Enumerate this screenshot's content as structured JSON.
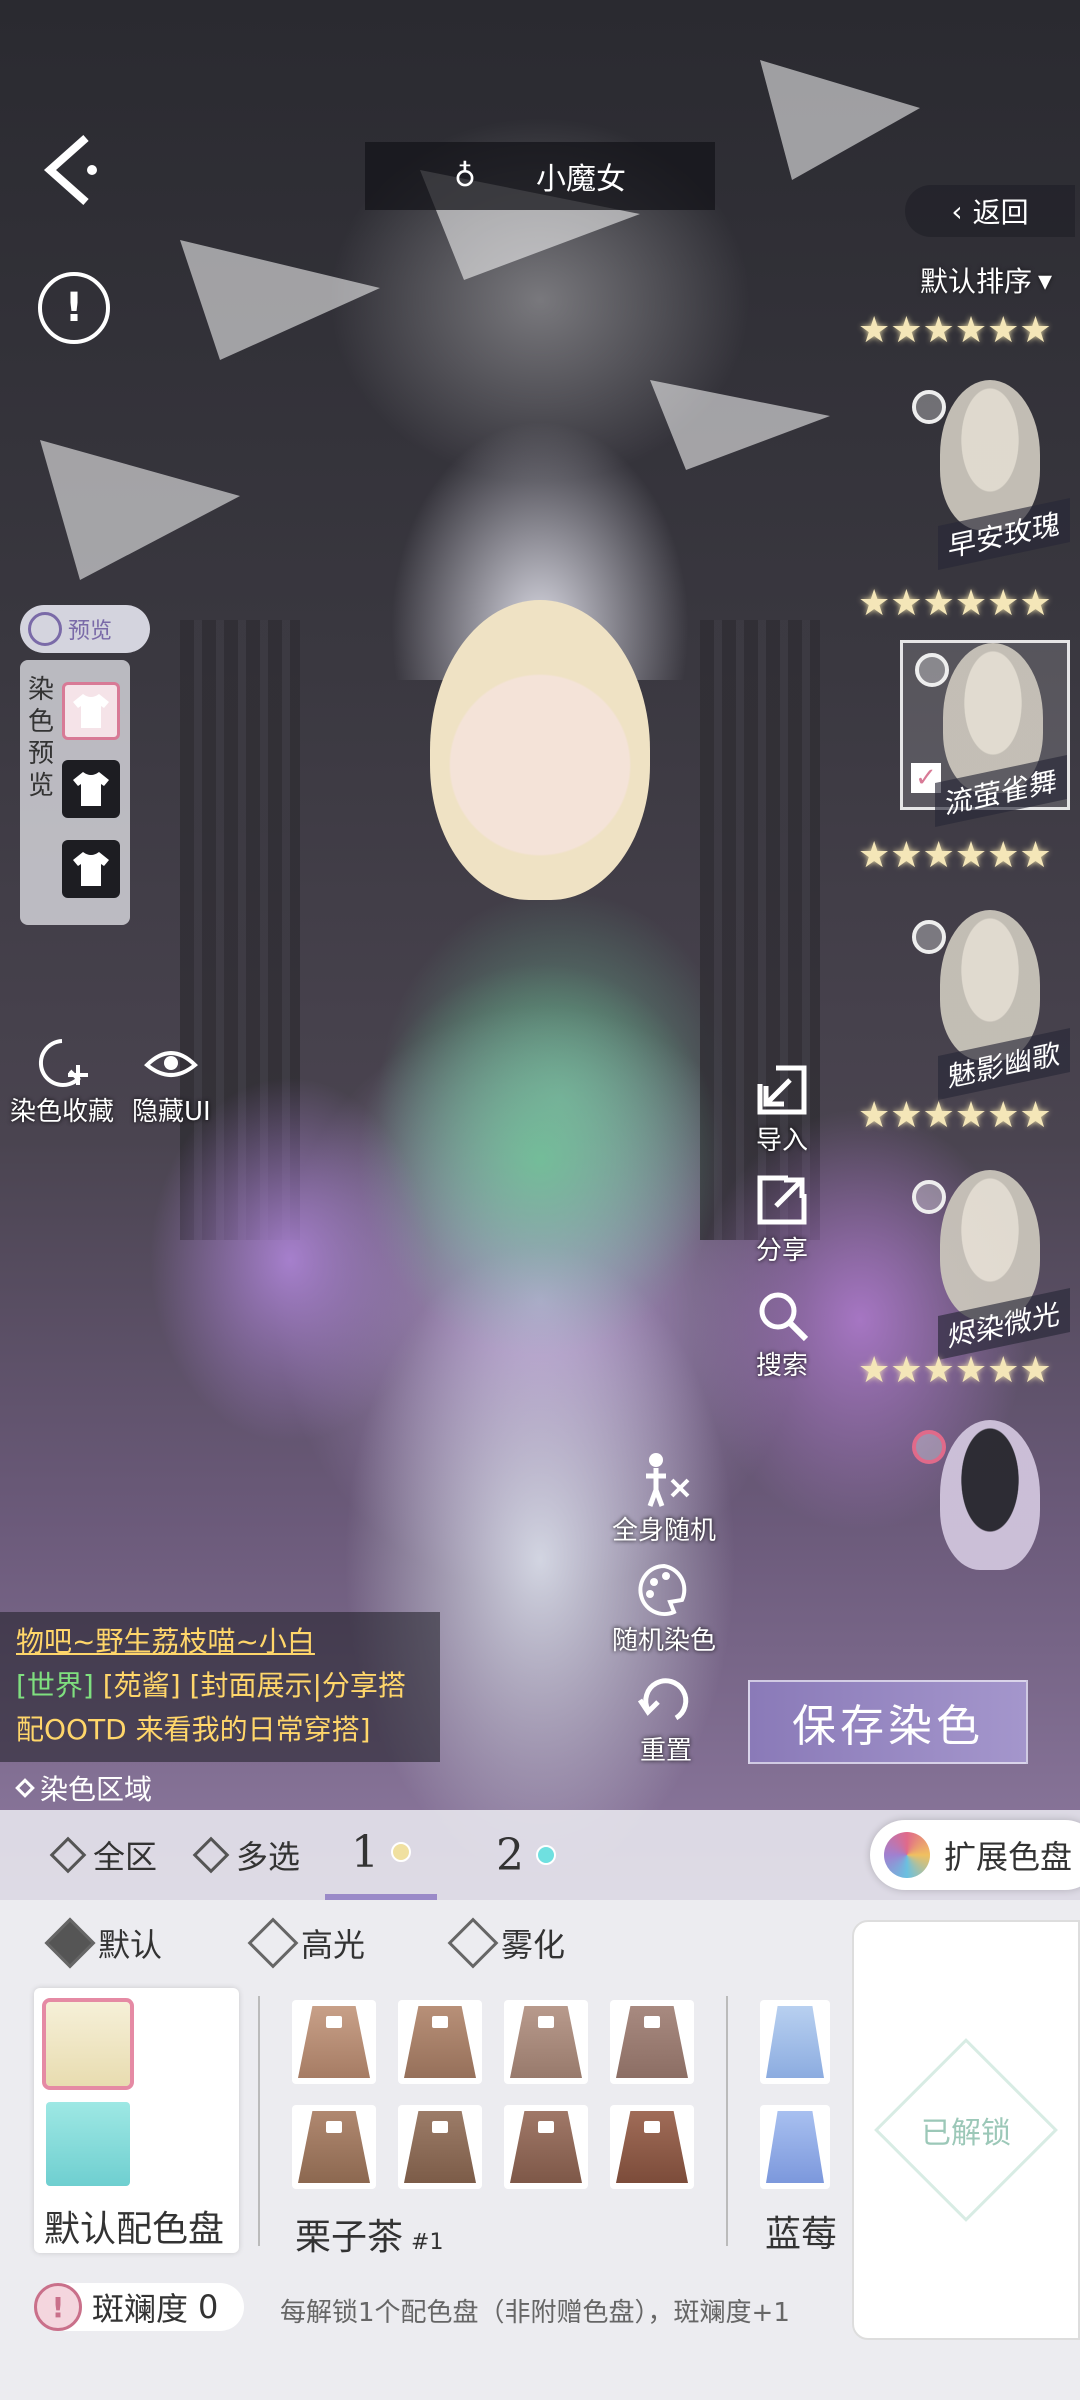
{
  "header": {
    "title": "小魔女",
    "return_label": "返回",
    "sort_label": "默认排序"
  },
  "dye_preview": {
    "pill_label": "预览",
    "side_label": "染色预览"
  },
  "left_tools": {
    "collect_label": "染色收藏",
    "hide_ui_label": "隐藏UI"
  },
  "characters": [
    {
      "name": "早安玫瑰",
      "stars": "★★★★★★"
    },
    {
      "name": "流萤雀舞",
      "stars": "★★★★★★"
    },
    {
      "name": "魅影幽歌",
      "stars": "★★★★★★"
    },
    {
      "name": "烬染微光",
      "stars": "★★★★★★"
    }
  ],
  "top_stars": "★★★★★★",
  "right_tools": {
    "import_label": "导入",
    "share_label": "分享",
    "search_label": "搜索",
    "random_all_label": "全身随机",
    "random_dye_label": "随机染色",
    "reset_label": "重置"
  },
  "chat": {
    "sender": "物吧~野生荔枝喵~小白",
    "channel": "[世界]",
    "nick": "[苑酱]",
    "msg1": "[封面展示|分享搭",
    "msg2": "配OOTD 来看我的日常穿搭]"
  },
  "save_label": "保存染色",
  "dye_region_label": "染色区域",
  "tabs": {
    "all_label": "全区",
    "multi_label": "多选",
    "tab1": "1",
    "tab2": "2",
    "extend_label": "扩展色盘"
  },
  "modes": {
    "default_label": "默认",
    "highlight_label": "高光",
    "fog_label": "雾化"
  },
  "palettes": {
    "default_name": "默认配色盘",
    "chestnut_name": "栗子茶",
    "chestnut_index": "#1",
    "blue_name": "蓝莓"
  },
  "unlocked_label": "已解锁",
  "spot": {
    "label": "斑斓度",
    "value": "0"
  },
  "hint": "每解锁1个配色盘（非附赠色盘），斑斓度+1",
  "colors": {
    "accent": "#9a8ac8",
    "pink": "#e58aa4",
    "dot_yellow": "#f0e0a0",
    "dot_cyan": "#6fe0e0"
  }
}
